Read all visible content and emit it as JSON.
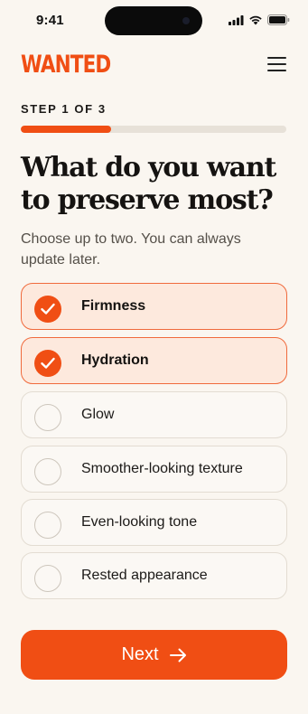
{
  "status_bar": {
    "time": "9:41",
    "icons": [
      "signal-icon",
      "wifi-icon",
      "battery-icon"
    ]
  },
  "header": {
    "logo": "WANTED",
    "menu_icon": "hamburger-menu-icon"
  },
  "step": {
    "label": "STEP 1 OF 3",
    "current": 1,
    "total": 3,
    "progress_fraction": 0.34
  },
  "question": {
    "title": "What do you want to preserve most?",
    "subtitle": "Choose up to two. You can always update later."
  },
  "options": [
    {
      "label": "Firmness",
      "selected": true
    },
    {
      "label": "Hydration",
      "selected": true
    },
    {
      "label": "Glow",
      "selected": false
    },
    {
      "label": "Smoother-looking texture",
      "selected": false
    },
    {
      "label": "Even-looking tone",
      "selected": false
    },
    {
      "label": "Rested appearance",
      "selected": false
    }
  ],
  "next_button": {
    "label": "Next",
    "icon": "arrow-right-icon"
  },
  "colors": {
    "accent": "#f04e14",
    "background": "#faf6f0",
    "selected_fill": "#fde9dd",
    "track": "#e7e1d8"
  }
}
